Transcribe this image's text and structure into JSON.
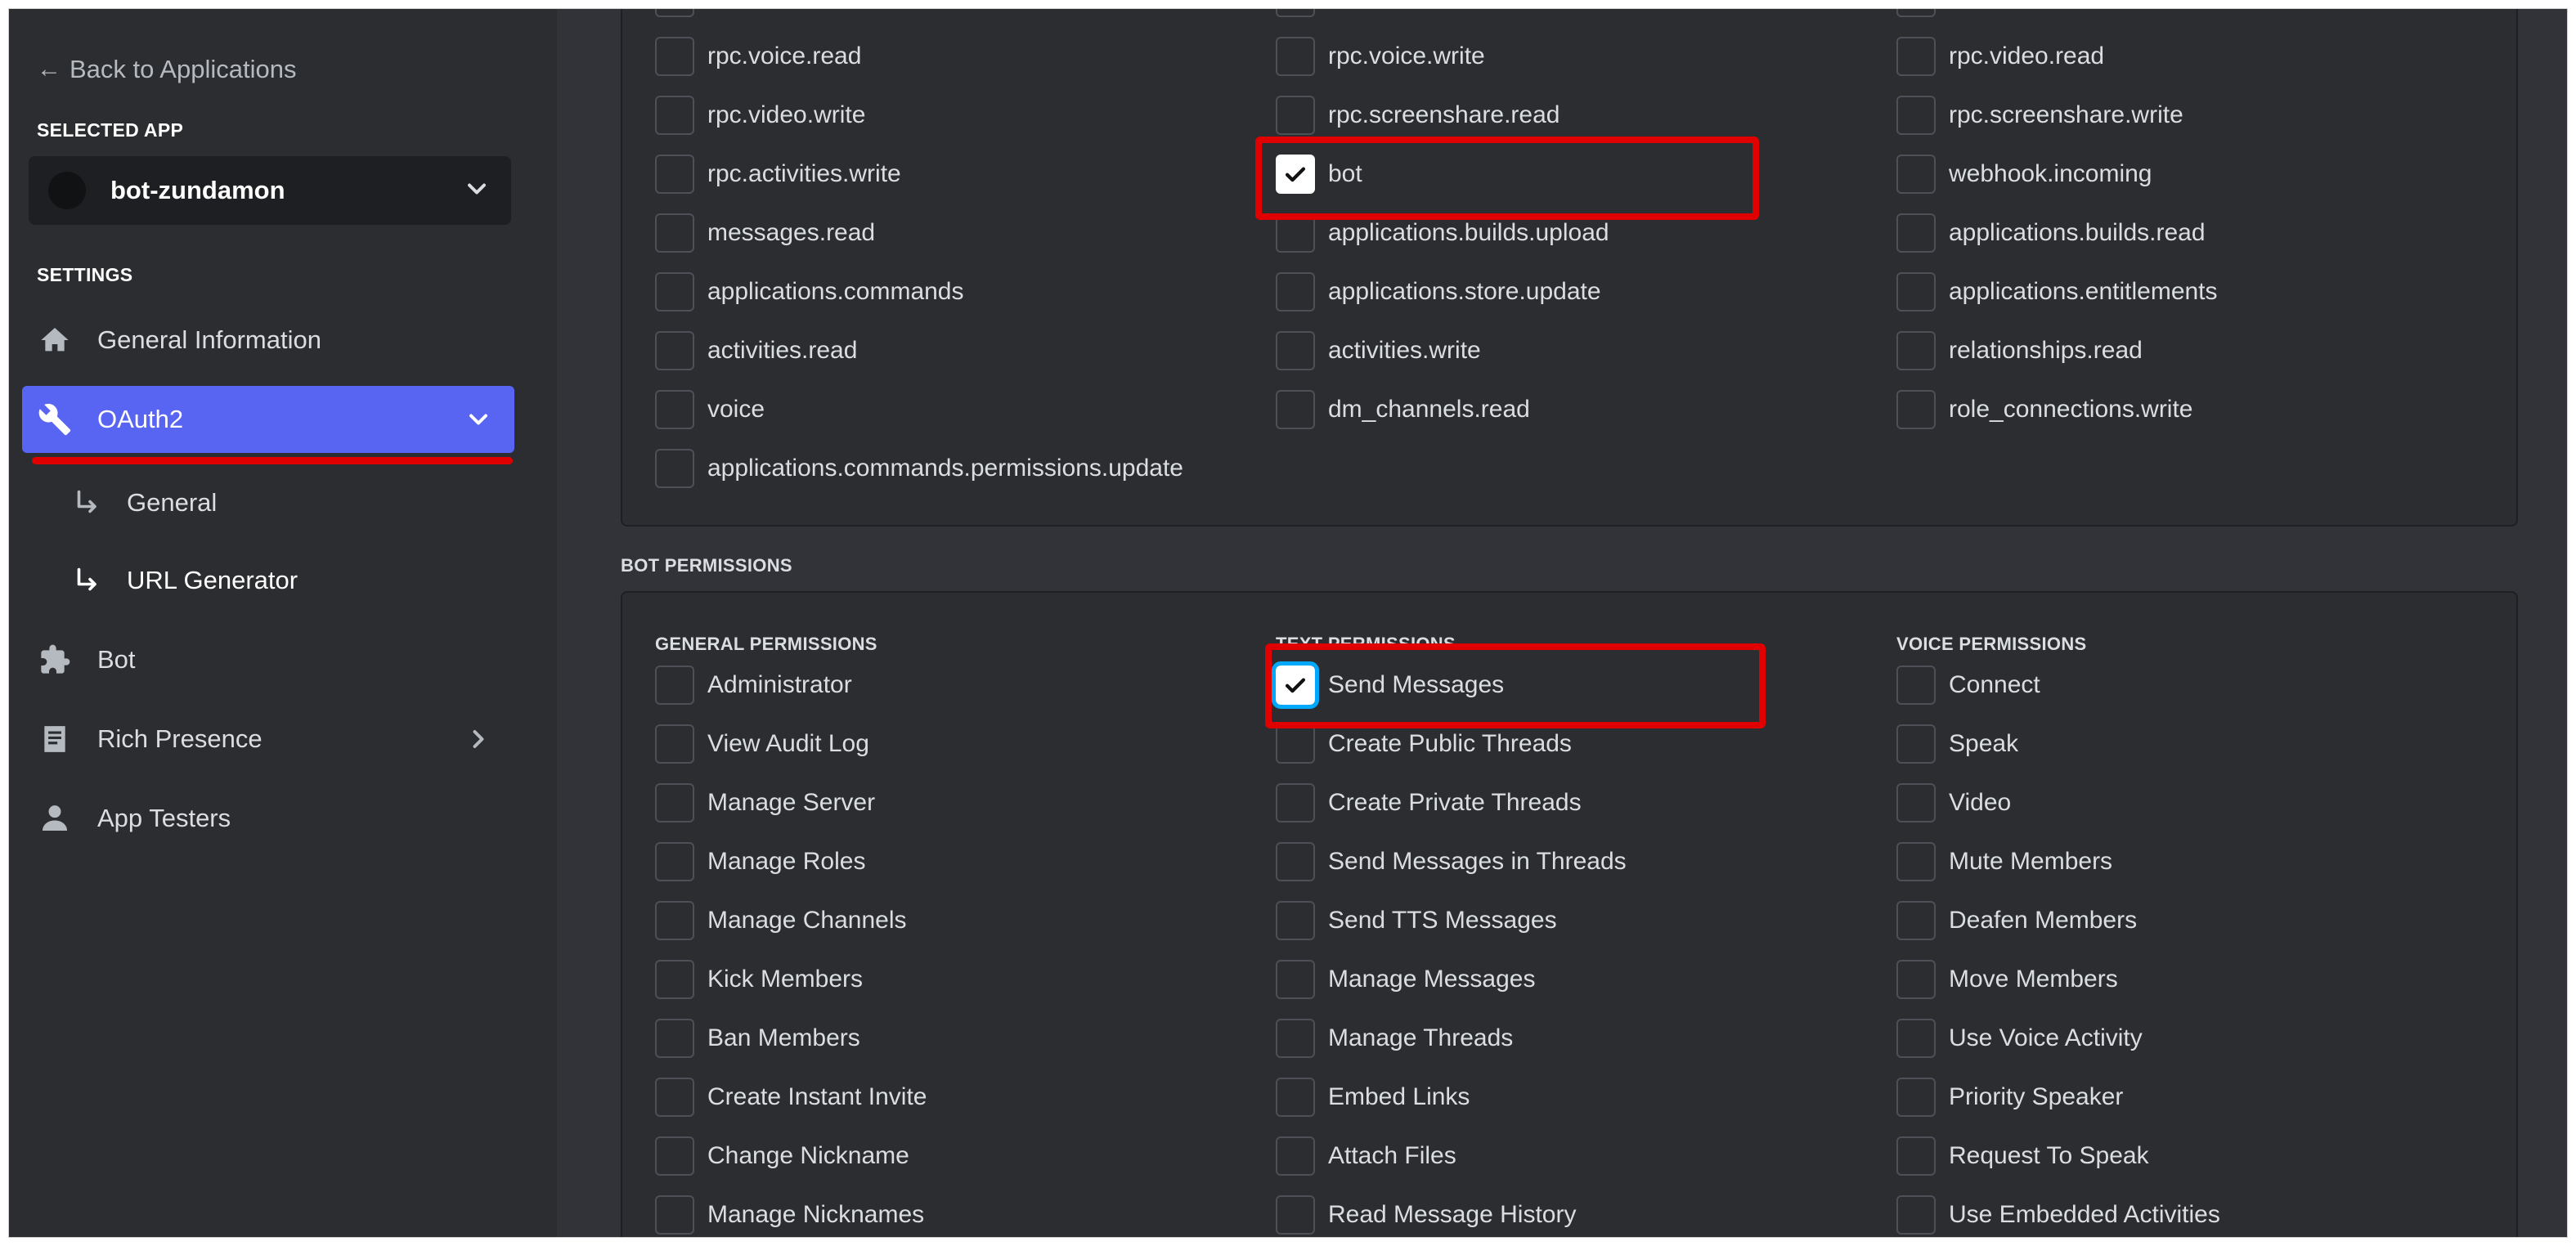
{
  "sidebar": {
    "back_label": "Back to Applications",
    "selected_app_heading": "SELECTED APP",
    "app_name": "bot-zundamon",
    "settings_heading": "SETTINGS",
    "items": [
      {
        "label": "General Information",
        "icon": "home-icon"
      },
      {
        "label": "OAuth2",
        "icon": "wrench-icon",
        "active": true
      },
      {
        "label": "General",
        "icon": "sub-arrow-icon"
      },
      {
        "label": "URL Generator",
        "icon": "sub-arrow-icon"
      },
      {
        "label": "Bot",
        "icon": "puzzle-icon"
      },
      {
        "label": "Rich Presence",
        "icon": "document-icon"
      },
      {
        "label": "App Testers",
        "icon": "user-icon"
      }
    ]
  },
  "scopes": {
    "col1": [
      {
        "label": "rpc.voice.read",
        "checked": false
      },
      {
        "label": "rpc.video.write",
        "checked": false
      },
      {
        "label": "rpc.activities.write",
        "checked": false
      },
      {
        "label": "messages.read",
        "checked": false
      },
      {
        "label": "applications.commands",
        "checked": false
      },
      {
        "label": "activities.read",
        "checked": false
      },
      {
        "label": "voice",
        "checked": false
      },
      {
        "label": "applications.commands.permissions.update",
        "checked": false
      }
    ],
    "col2": [
      {
        "label": "rpc.voice.write",
        "checked": false
      },
      {
        "label": "rpc.screenshare.read",
        "checked": false
      },
      {
        "label": "bot",
        "checked": true
      },
      {
        "label": "applications.builds.upload",
        "checked": false
      },
      {
        "label": "applications.store.update",
        "checked": false
      },
      {
        "label": "activities.write",
        "checked": false
      },
      {
        "label": "dm_channels.read",
        "checked": false
      }
    ],
    "col3": [
      {
        "label": "rpc.video.read",
        "checked": false
      },
      {
        "label": "rpc.screenshare.write",
        "checked": false
      },
      {
        "label": "webhook.incoming",
        "checked": false
      },
      {
        "label": "applications.builds.read",
        "checked": false
      },
      {
        "label": "applications.entitlements",
        "checked": false
      },
      {
        "label": "relationships.read",
        "checked": false
      },
      {
        "label": "role_connections.write",
        "checked": false
      }
    ]
  },
  "bot_permissions": {
    "heading": "BOT PERMISSIONS",
    "general_heading": "GENERAL PERMISSIONS",
    "text_heading": "TEXT PERMISSIONS",
    "voice_heading": "VOICE PERMISSIONS",
    "general": [
      {
        "label": "Administrator",
        "checked": false
      },
      {
        "label": "View Audit Log",
        "checked": false
      },
      {
        "label": "Manage Server",
        "checked": false
      },
      {
        "label": "Manage Roles",
        "checked": false
      },
      {
        "label": "Manage Channels",
        "checked": false
      },
      {
        "label": "Kick Members",
        "checked": false
      },
      {
        "label": "Ban Members",
        "checked": false
      },
      {
        "label": "Create Instant Invite",
        "checked": false
      },
      {
        "label": "Change Nickname",
        "checked": false
      },
      {
        "label": "Manage Nicknames",
        "checked": false
      }
    ],
    "text": [
      {
        "label": "Send Messages",
        "checked": true
      },
      {
        "label": "Create Public Threads",
        "checked": false
      },
      {
        "label": "Create Private Threads",
        "checked": false
      },
      {
        "label": "Send Messages in Threads",
        "checked": false
      },
      {
        "label": "Send TTS Messages",
        "checked": false
      },
      {
        "label": "Manage Messages",
        "checked": false
      },
      {
        "label": "Manage Threads",
        "checked": false
      },
      {
        "label": "Embed Links",
        "checked": false
      },
      {
        "label": "Attach Files",
        "checked": false
      },
      {
        "label": "Read Message History",
        "checked": false
      }
    ],
    "voice": [
      {
        "label": "Connect",
        "checked": false
      },
      {
        "label": "Speak",
        "checked": false
      },
      {
        "label": "Video",
        "checked": false
      },
      {
        "label": "Mute Members",
        "checked": false
      },
      {
        "label": "Deafen Members",
        "checked": false
      },
      {
        "label": "Move Members",
        "checked": false
      },
      {
        "label": "Use Voice Activity",
        "checked": false
      },
      {
        "label": "Priority Speaker",
        "checked": false
      },
      {
        "label": "Request To Speak",
        "checked": false
      },
      {
        "label": "Use Embedded Activities",
        "checked": false
      }
    ]
  },
  "colors": {
    "accent": "#5865f2",
    "highlight": "#e00000",
    "focus": "#00a8fc"
  }
}
